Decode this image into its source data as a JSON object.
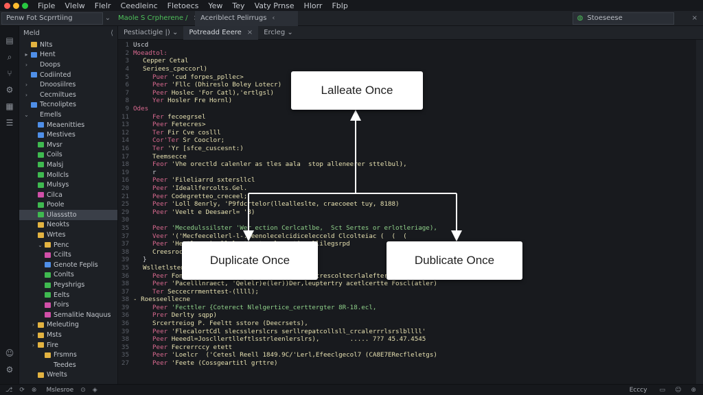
{
  "menubar": {
    "items": [
      "Fiple",
      "Vlelw",
      "Flelr",
      "Ceedleinc",
      "Fletoecs",
      "Yew",
      "Tey",
      "Vaty Prnse",
      "Hlorr",
      "Fblp"
    ]
  },
  "tabstrip": {
    "search_value": "Penw Fot Scprrtiing",
    "tab_group": "Maole  S  Crpherene /",
    "active_tab": "Aceriblect Pelirrugs",
    "right_value": "Stoeseese"
  },
  "sidebar": {
    "title": "Meld",
    "items": [
      {
        "label": "Nlts",
        "indent": 0,
        "twisty": "",
        "color": "#e3b341"
      },
      {
        "label": "Hent",
        "indent": 0,
        "twisty": "▸",
        "color": "#4f8fe8"
      },
      {
        "label": "Doops",
        "indent": 0,
        "twisty": "›",
        "color": ""
      },
      {
        "label": "Codiinted",
        "indent": 0,
        "twisty": "",
        "color": "#4f8fe8"
      },
      {
        "label": "Dnoosiilres",
        "indent": 0,
        "twisty": "›",
        "color": ""
      },
      {
        "label": "Cecmiltues",
        "indent": 0,
        "twisty": "›",
        "color": ""
      },
      {
        "label": "Tecnoliptes",
        "indent": 0,
        "twisty": "",
        "color": "#4f8fe8"
      },
      {
        "label": "Emells",
        "indent": 0,
        "twisty": "⌄",
        "color": ""
      },
      {
        "label": "Meaenitties",
        "indent": 1,
        "twisty": "",
        "color": "#4f8fe8"
      },
      {
        "label": "Mestives",
        "indent": 1,
        "twisty": "",
        "color": "#4f8fe8"
      },
      {
        "label": "Mvsr",
        "indent": 1,
        "twisty": "",
        "color": "#3fb950"
      },
      {
        "label": "Coils",
        "indent": 1,
        "twisty": "",
        "color": "#3fb950"
      },
      {
        "label": "Malsj",
        "indent": 1,
        "twisty": "",
        "color": "#3fb950"
      },
      {
        "label": "Mollcls",
        "indent": 1,
        "twisty": "",
        "color": "#3fb950"
      },
      {
        "label": "Mulsys",
        "indent": 1,
        "twisty": "",
        "color": "#3fb950"
      },
      {
        "label": "Cilca",
        "indent": 1,
        "twisty": "",
        "color": "#d14fa8"
      },
      {
        "label": "Poole",
        "indent": 1,
        "twisty": "",
        "color": "#3fb950"
      },
      {
        "label": "Ulassstto",
        "indent": 1,
        "twisty": "",
        "color": "#3fb950",
        "selected": true
      },
      {
        "label": "Neokts",
        "indent": 1,
        "twisty": "",
        "color": "#e3b341"
      },
      {
        "label": "Wrtes",
        "indent": 1,
        "twisty": "",
        "color": "#e3b341"
      },
      {
        "label": "Penc",
        "indent": 2,
        "twisty": "⌄",
        "color": "#e3b341"
      },
      {
        "label": "Ccilts",
        "indent": 2,
        "twisty": "",
        "color": "#d14fa8"
      },
      {
        "label": "Genote Feplis",
        "indent": 2,
        "twisty": "",
        "color": "#4f8fe8"
      },
      {
        "label": "Conlts",
        "indent": 2,
        "twisty": "",
        "color": "#3fb950"
      },
      {
        "label": "Peyshrigs",
        "indent": 2,
        "twisty": "",
        "color": "#3fb950"
      },
      {
        "label": "Eelts",
        "indent": 2,
        "twisty": "",
        "color": "#3fb950"
      },
      {
        "label": "Foirs",
        "indent": 2,
        "twisty": "",
        "color": "#d14fa8"
      },
      {
        "label": "Semalitie Naquus",
        "indent": 2,
        "twisty": "",
        "color": "#d14fa8"
      },
      {
        "label": "Meleuting",
        "indent": 1,
        "twisty": "›",
        "color": "#e3b341"
      },
      {
        "label": "Msts",
        "indent": 1,
        "twisty": "›",
        "color": "#e3b341"
      },
      {
        "label": "Fire",
        "indent": 1,
        "twisty": "›",
        "color": "#e3b341"
      },
      {
        "label": "Frsmns",
        "indent": 2,
        "twisty": "",
        "color": "#e3b341"
      },
      {
        "label": "Teedes",
        "indent": 2,
        "twisty": "",
        "color": ""
      },
      {
        "label": "Wrelts",
        "indent": 1,
        "twisty": "",
        "color": "#e3b341"
      }
    ]
  },
  "editor": {
    "tabs": [
      {
        "label": "Pestiactigle  |)  ⌄",
        "active": false
      },
      {
        "label": "Potreadd Eeere",
        "active": true,
        "close": "×"
      },
      {
        "label": "Ercleg ⌄",
        "active": false
      }
    ],
    "lines": [
      {
        "n": "1",
        "indent": 0,
        "kw": "",
        "text": "Uscd",
        "cls": "ct"
      },
      {
        "n": "2",
        "indent": 0,
        "kw": "",
        "text": "Moeadtol:",
        "cls": "kw"
      },
      {
        "n": "3",
        "indent": 1,
        "kw": "",
        "text": "Cepper Cetal",
        "cls": "st"
      },
      {
        "n": "4",
        "indent": 1,
        "kw": "",
        "text": "Seriees_cpeccorl)",
        "cls": "st"
      },
      {
        "n": "5",
        "indent": 2,
        "kw": "Puer",
        "text": "'cud forpes_ppllec>",
        "cls": "st"
      },
      {
        "n": "6",
        "indent": 2,
        "kw": "Peer",
        "text": "'Fllc (Dhireslo Boley Lotecr)",
        "cls": "st"
      },
      {
        "n": "7",
        "indent": 2,
        "kw": "Peer",
        "text": "Hoslec 'For Catl),'ertlgsl)",
        "cls": "st"
      },
      {
        "n": "8",
        "indent": 2,
        "kw": "Yer",
        "text": "Hosler Fre Hornl)",
        "cls": "st"
      },
      {
        "n": "9",
        "indent": 0,
        "kw": "",
        "text": "Odes",
        "cls": "kw"
      },
      {
        "n": "11",
        "indent": 2,
        "kw": "Fer",
        "text": "fecoegrsel",
        "cls": "st"
      },
      {
        "n": "13",
        "indent": 2,
        "kw": "Peer",
        "text": "Fetecres>",
        "cls": "st"
      },
      {
        "n": "12",
        "indent": 2,
        "kw": "Ter",
        "text": "Fir Cve coslll",
        "cls": "st"
      },
      {
        "n": "14",
        "indent": 2,
        "kw": "Cor'Ter",
        "text": "Sr Cooclor;",
        "cls": "st"
      },
      {
        "n": "16",
        "indent": 2,
        "kw": "Ter",
        "text": "'Yr [sfce_cuscesnt:)",
        "cls": "st"
      },
      {
        "n": "17",
        "indent": 2,
        "kw": "",
        "text": "Teemsecce",
        "cls": "st"
      },
      {
        "n": "18",
        "indent": 2,
        "kw": "Feor",
        "text": "'Vhe orectld calenler as tles aala  stop alleneerer sttelbul),",
        "cls": "st"
      },
      {
        "n": "19",
        "indent": 2,
        "kw": "",
        "text": "r",
        "cls": "ct"
      },
      {
        "n": "16",
        "indent": 2,
        "kw": "Peer",
        "text": "'Fileliarrd sxtersllcl",
        "cls": "st"
      },
      {
        "n": "20",
        "indent": 2,
        "kw": "Peer",
        "text": "'Ideallfercolts.Gel.",
        "cls": "st"
      },
      {
        "n": "21",
        "indent": 2,
        "kw": "Peer",
        "text": "Codegretteo_creceel;",
        "cls": "st"
      },
      {
        "n": "25",
        "indent": 2,
        "kw": "Peer",
        "text": "'Loll 8enrly, 'P9fdcrtelor(llealleslte, craecoeet tuy, 8188)",
        "cls": "st"
      },
      {
        "n": "29",
        "indent": 2,
        "kw": "Peer",
        "text": "'Veelt e Deesaerl= '8)",
        "cls": "st"
      },
      {
        "n": "30",
        "indent": 0,
        "kw": "",
        "text": "",
        "cls": "ct"
      },
      {
        "n": "35",
        "indent": 2,
        "kw": "Peer",
        "text": "'Mecedulssilster 'Wer ection Cerlcatlbe,  Sct Sertes or erlotleriage),",
        "cls": "cm"
      },
      {
        "n": "37",
        "indent": 2,
        "kw": "Veer",
        "text": "'('Mecfeecellerl-l-.leenolecelcidicelecceld Clcolteiac (  (  (",
        "cls": "st"
      },
      {
        "n": "37",
        "indent": 2,
        "kw": "Peer",
        "text": "'Heetlaeer), llelert-estacelers.tire llilegsrpd",
        "cls": "st"
      },
      {
        "n": "38",
        "indent": 2,
        "kw": "",
        "text": "Creesroclet",
        "cls": "st"
      },
      {
        "n": "39",
        "indent": 1,
        "kw": "",
        "text": "}",
        "cls": "ct"
      },
      {
        "n": "35",
        "indent": 1,
        "kw": "",
        "text": "Wslletlsten",
        "cls": "st"
      },
      {
        "n": "36",
        "indent": 2,
        "kw": "Peer",
        "text": "Fonls' scatllcasterrlolt flolt '~Het' crescoltecrlaleftererlss)",
        "cls": "st"
      },
      {
        "n": "38",
        "indent": 2,
        "kw": "Peer",
        "text": "'Pacelllnraect, 'Qelelr)e(ler))Der,leuptertry acetlcertte Foscl(atler)",
        "cls": "st"
      },
      {
        "n": "37",
        "indent": 2,
        "kw": "Ter",
        "text": "Seccecrrmenttest-(llll);",
        "cls": "st"
      },
      {
        "n": "38",
        "indent": 0,
        "kw": "",
        "text": "- Roesseellecne",
        "cls": "st"
      },
      {
        "n": "39",
        "indent": 2,
        "kw": "Peer",
        "text": "'Fecttler {Coterect Nlelgertice_certtergter 8R-18.ecl,",
        "cls": "cm"
      },
      {
        "n": "36",
        "indent": 2,
        "kw": "Prer",
        "text": "Derlty sqpp)",
        "cls": "st"
      },
      {
        "n": "36",
        "indent": 2,
        "kw": "",
        "text": "Srcertreiog P. Feeltt sstore (Deecrsets),",
        "cls": "st"
      },
      {
        "n": "39",
        "indent": 2,
        "kw": "Peer",
        "text": "'FlecalortCdl slecsslerslcrs serllrepatcollsll_crcalerrrlsrslbllll'",
        "cls": "st"
      },
      {
        "n": "38",
        "indent": 2,
        "kw": "Peer",
        "text": "Heeedl=Joscllertlleftlsstrleenlerslrs),        ..... 7?7 45.47.4545",
        "cls": "st"
      },
      {
        "n": "35",
        "indent": 2,
        "kw": "Peer",
        "text": "Fecrerrccy etett",
        "cls": "st"
      },
      {
        "n": "35",
        "indent": 2,
        "kw": "Peer",
        "text": "'Loelcr  ('Cetesl Reell 1849.9C/'Lerl,Efeeclgecol7 (CA8E7ERecfleletgs)",
        "cls": "st"
      },
      {
        "n": "27",
        "indent": 2,
        "kw": "Peer",
        "text": "'Feete (Cossgeartitl grttre)",
        "cls": "st"
      }
    ]
  },
  "diagram": {
    "top_box": "Lalleate Once",
    "left_box": "Duplicate Once",
    "right_box": "Dublicate Once"
  },
  "statusbar": {
    "left": "Mslesroe",
    "right": "Ecccy"
  }
}
